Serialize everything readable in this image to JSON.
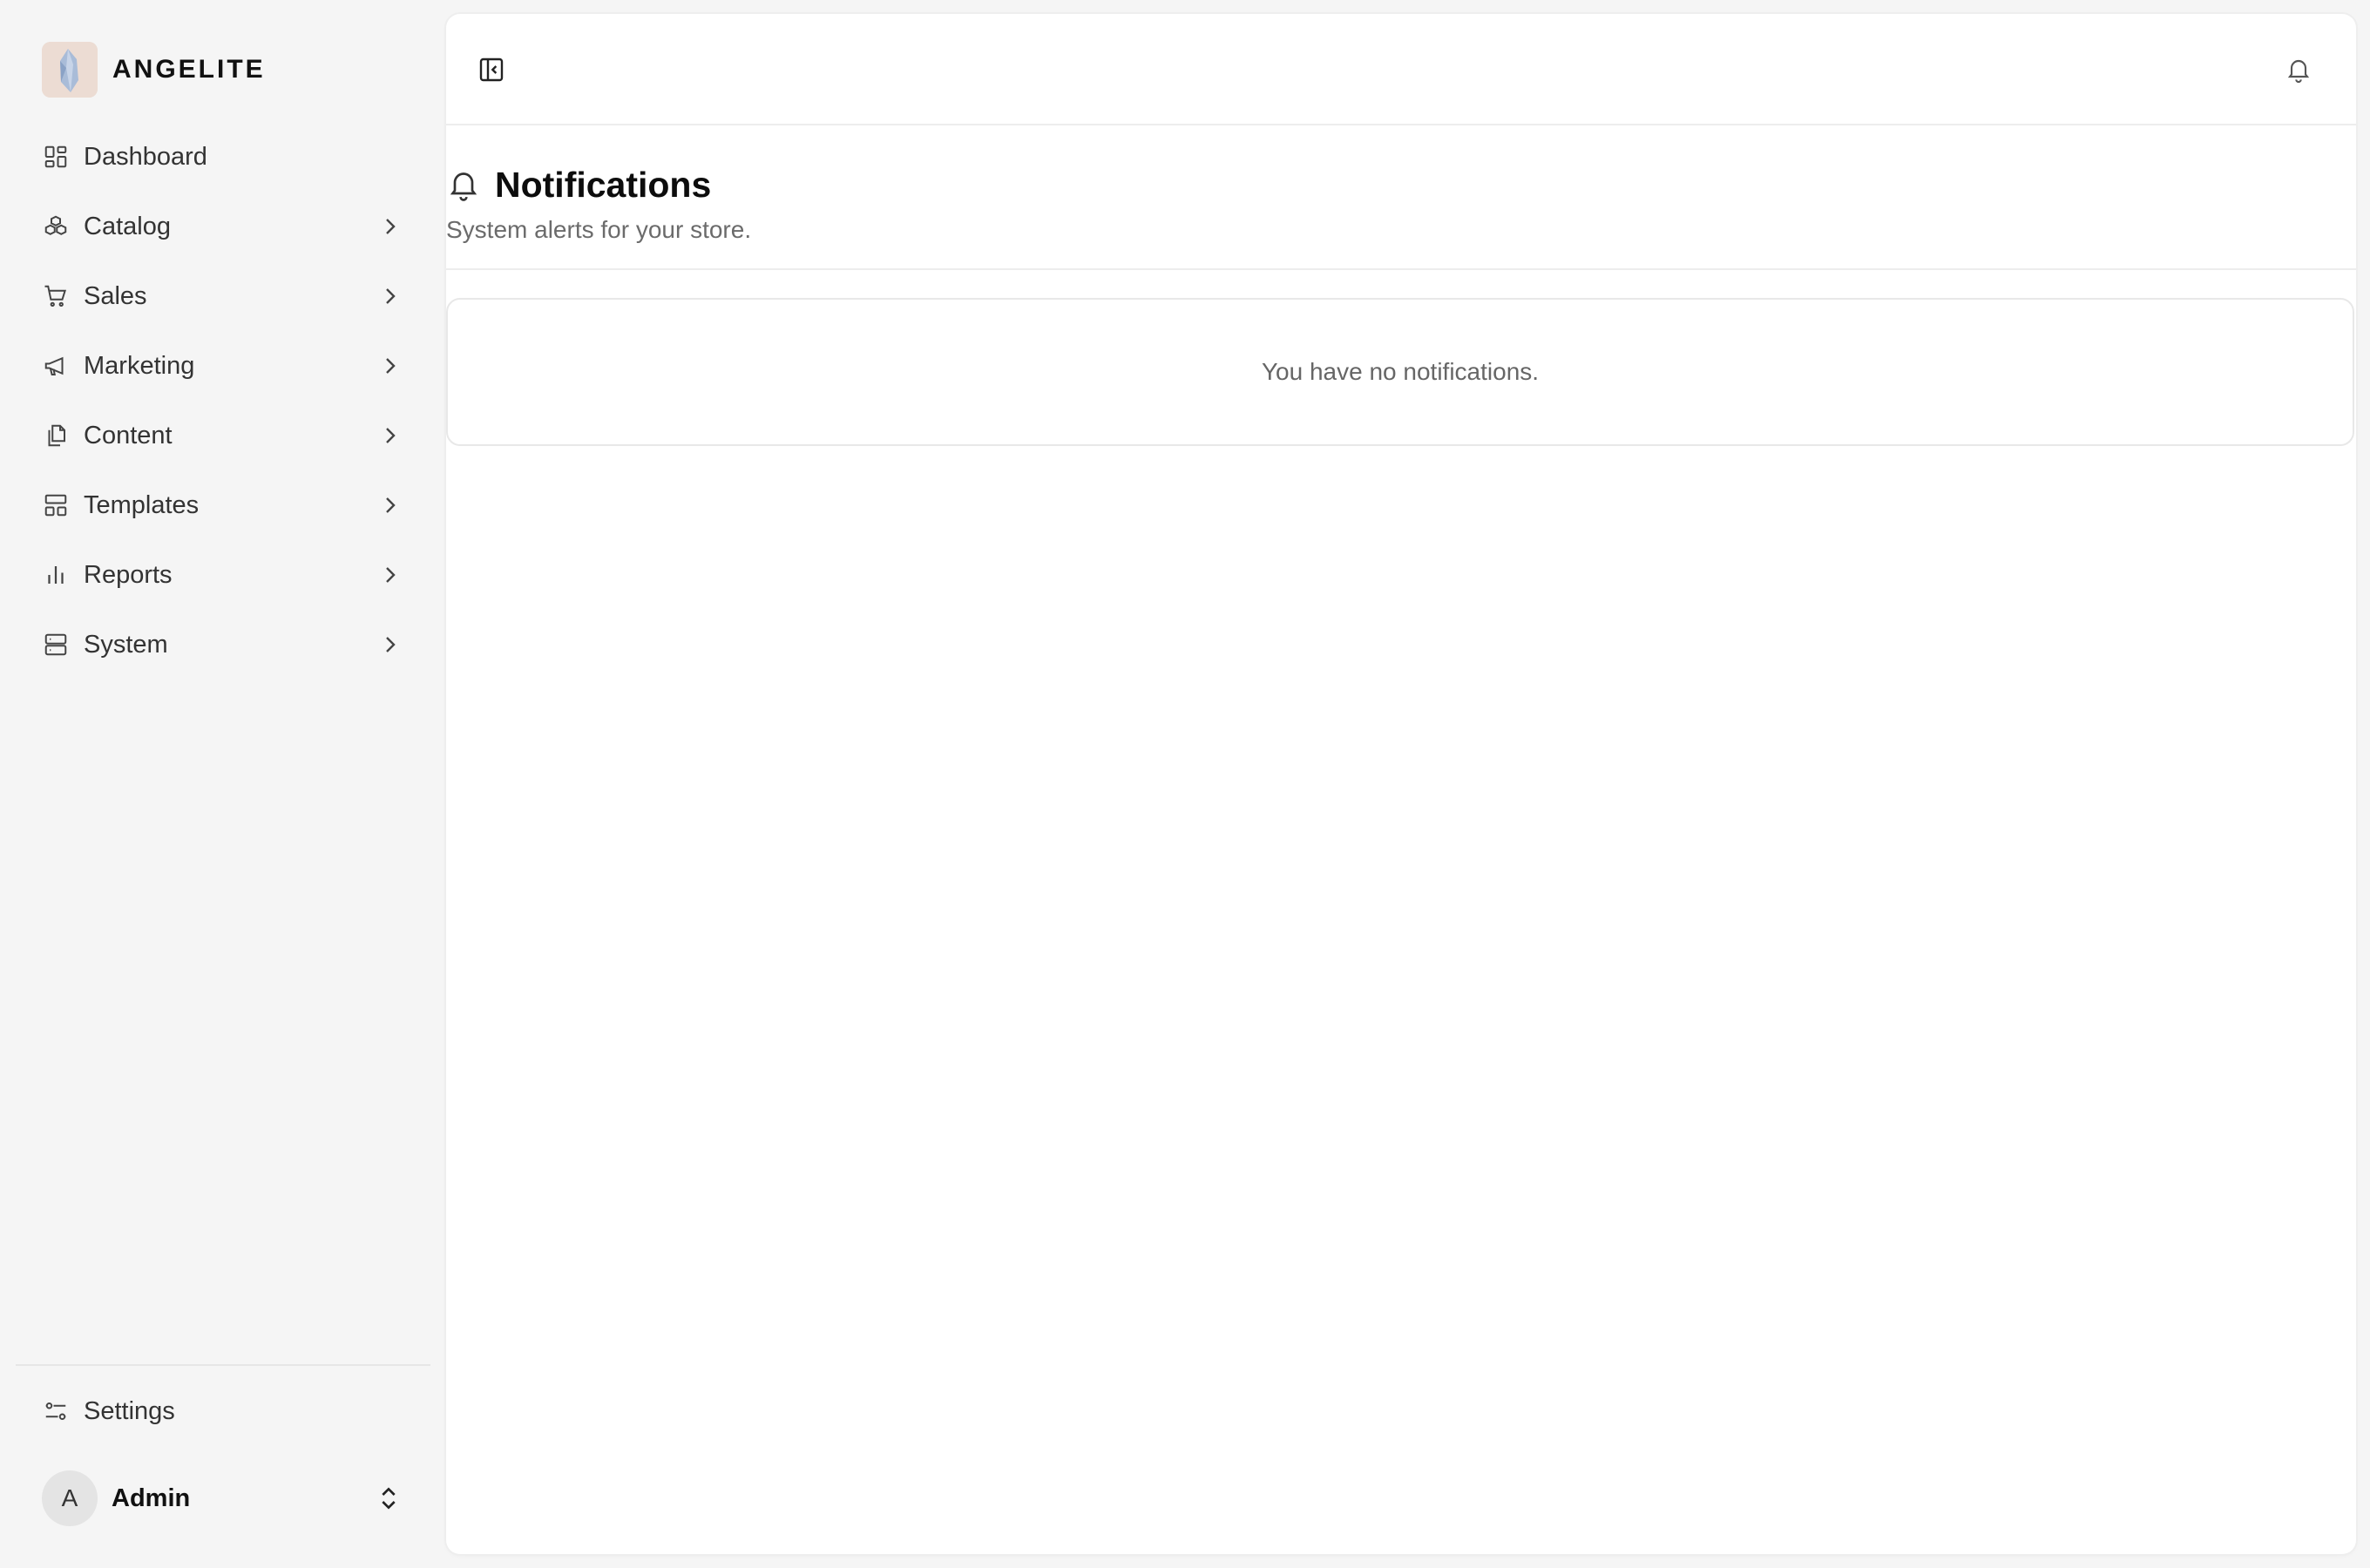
{
  "brand": {
    "name": "ANGELITE"
  },
  "nav": {
    "items": [
      {
        "label": "Dashboard",
        "icon": "dashboard-icon",
        "has_children": false
      },
      {
        "label": "Catalog",
        "icon": "boxes-icon",
        "has_children": true
      },
      {
        "label": "Sales",
        "icon": "cart-icon",
        "has_children": true
      },
      {
        "label": "Marketing",
        "icon": "megaphone-icon",
        "has_children": true
      },
      {
        "label": "Content",
        "icon": "files-icon",
        "has_children": true
      },
      {
        "label": "Templates",
        "icon": "layout-icon",
        "has_children": true
      },
      {
        "label": "Reports",
        "icon": "bar-chart-icon",
        "has_children": true
      },
      {
        "label": "System",
        "icon": "server-icon",
        "has_children": true
      }
    ],
    "settings": {
      "label": "Settings",
      "icon": "sliders-icon"
    }
  },
  "user": {
    "initial": "A",
    "name": "Admin"
  },
  "page": {
    "title": "Notifications",
    "subtitle": "System alerts for your store.",
    "empty_message": "You have no notifications."
  },
  "colors": {
    "sidebar_bg": "#f5f5f5",
    "main_bg": "#ffffff",
    "text_primary": "#0d0d0d",
    "text_muted": "#6b6b6b",
    "border": "#e8e8e8"
  }
}
